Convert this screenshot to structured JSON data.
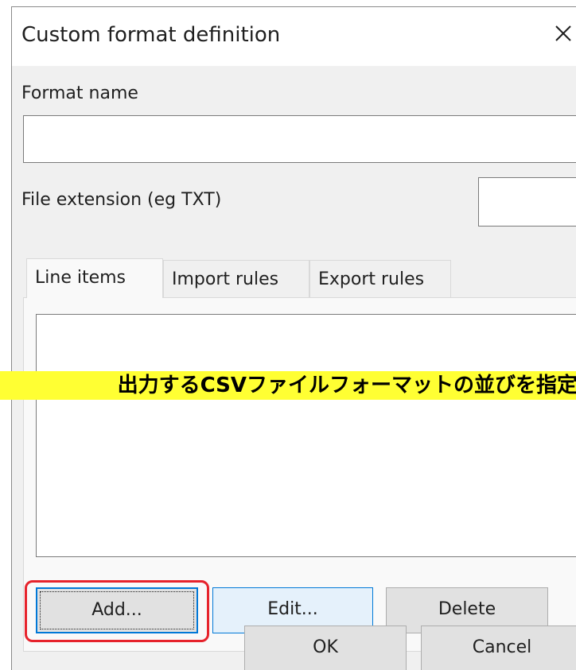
{
  "dialog": {
    "title": "Custom format definition",
    "format_name_label": "Format name",
    "format_name_value": "",
    "file_extension_label": "File extension (eg TXT)",
    "file_extension_value": ""
  },
  "tabs": [
    {
      "label": "Line items",
      "active": true
    },
    {
      "label": "Import rules",
      "active": false
    },
    {
      "label": "Export rules",
      "active": false
    }
  ],
  "line_items": [],
  "buttons": {
    "add": "Add...",
    "edit": "Edit...",
    "delete": "Delete",
    "ok": "OK",
    "cancel": "Cancel"
  },
  "annotation": {
    "banner_text": "出力するCSVファイルフォーマットの並びを指定",
    "banner_color": "#ffff33",
    "highlight_color": "#e6232c"
  }
}
